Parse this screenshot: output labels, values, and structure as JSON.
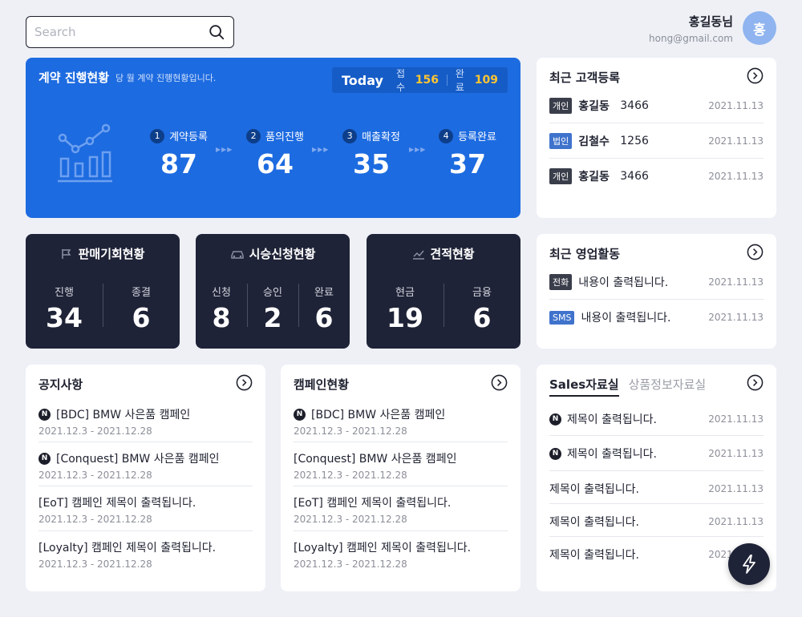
{
  "search": {
    "placeholder": "Search"
  },
  "user": {
    "name": "홍길동님",
    "email": "hong@gmail.com",
    "avatar_text": "홍"
  },
  "contract": {
    "title": "계약 진행현황",
    "subtitle": "당 월 계약 진행현황입니다.",
    "today": {
      "label": "Today",
      "received_label": "접수",
      "received_value": "156",
      "done_label": "완료",
      "done_value": "109"
    },
    "steps": [
      {
        "num": "1",
        "label": "계약등록",
        "value": "87"
      },
      {
        "num": "2",
        "label": "품의진행",
        "value": "64"
      },
      {
        "num": "3",
        "label": "매출확정",
        "value": "35"
      },
      {
        "num": "4",
        "label": "등록완료",
        "value": "37"
      }
    ]
  },
  "sales_opportunity": {
    "title": "판매기회현황",
    "items": [
      {
        "label": "진행",
        "value": "34"
      },
      {
        "label": "종결",
        "value": "6"
      }
    ]
  },
  "test_drive": {
    "title": "시승신청현황",
    "items": [
      {
        "label": "신청",
        "value": "8"
      },
      {
        "label": "승인",
        "value": "2"
      },
      {
        "label": "완료",
        "value": "6"
      }
    ]
  },
  "quote": {
    "title": "견적현황",
    "items": [
      {
        "label": "현금",
        "value": "19"
      },
      {
        "label": "금융",
        "value": "6"
      }
    ]
  },
  "recent_customers": {
    "title": "최근 고객등록",
    "rows": [
      {
        "badge": "개인",
        "name": "홍길동",
        "code": "3466",
        "date": "2021.11.13"
      },
      {
        "badge": "법인",
        "name": "김철수",
        "code": "1256",
        "date": "2021.11.13"
      },
      {
        "badge": "개인",
        "name": "홍길동",
        "code": "3466",
        "date": "2021.11.13"
      }
    ]
  },
  "recent_activity": {
    "title": "최근 영업활동",
    "rows": [
      {
        "badge": "전화",
        "text": "내용이 출력됩니다.",
        "date": "2021.11.13"
      },
      {
        "badge": "SMS",
        "text": "내용이 출력됩니다.",
        "date": "2021.11.13"
      }
    ]
  },
  "notices": {
    "title": "공지사항",
    "items": [
      {
        "new": "N",
        "title": "[BDC] BMW 사은품 캠페인",
        "period": "2021.12.3 - 2021.12.28"
      },
      {
        "new": "N",
        "title": "[Conquest] BMW 사은품 캠페인",
        "period": "2021.12.3 - 2021.12.28"
      },
      {
        "new": "",
        "title": "[EoT] 캠페인 제목이 출력됩니다.",
        "period": "2021.12.3 - 2021.12.28"
      },
      {
        "new": "",
        "title": "[Loyalty] 캠페인 제목이 출력됩니다.",
        "period": "2021.12.3 - 2021.12.28"
      }
    ]
  },
  "campaigns": {
    "title": "캠페인현황",
    "items": [
      {
        "new": "N",
        "title": "[BDC] BMW 사은품 캠페인",
        "period": "2021.12.3 - 2021.12.28"
      },
      {
        "new": "",
        "title": "[Conquest] BMW 사은품 캠페인",
        "period": "2021.12.3 - 2021.12.28"
      },
      {
        "new": "",
        "title": "[EoT] 캠페인 제목이 출력됩니다.",
        "period": "2021.12.3 - 2021.12.28"
      },
      {
        "new": "",
        "title": "[Loyalty] 캠페인 제목이 출력됩니다.",
        "period": "2021.12.3 - 2021.12.28"
      }
    ]
  },
  "resources": {
    "tab_active": "Sales자료실",
    "tab_inactive": "상품정보자료실",
    "rows": [
      {
        "new": "N",
        "title": "제목이 출력됩니다.",
        "date": "2021.11.13"
      },
      {
        "new": "N",
        "title": "제목이 출력됩니다.",
        "date": "2021.11.13"
      },
      {
        "new": "",
        "title": "제목이 출력됩니다.",
        "date": "2021.11.13"
      },
      {
        "new": "",
        "title": "제목이 출력됩니다.",
        "date": "2021.11.13"
      },
      {
        "new": "",
        "title": "제목이 출력됩니다.",
        "date": "2021.11.13"
      }
    ]
  },
  "icons": {
    "fab": "lightning-icon",
    "more": "chevron-right-circle-icon"
  },
  "colors": {
    "primary": "#1d6be0",
    "dark": "#1f2337",
    "highlight": "#ffc531"
  }
}
